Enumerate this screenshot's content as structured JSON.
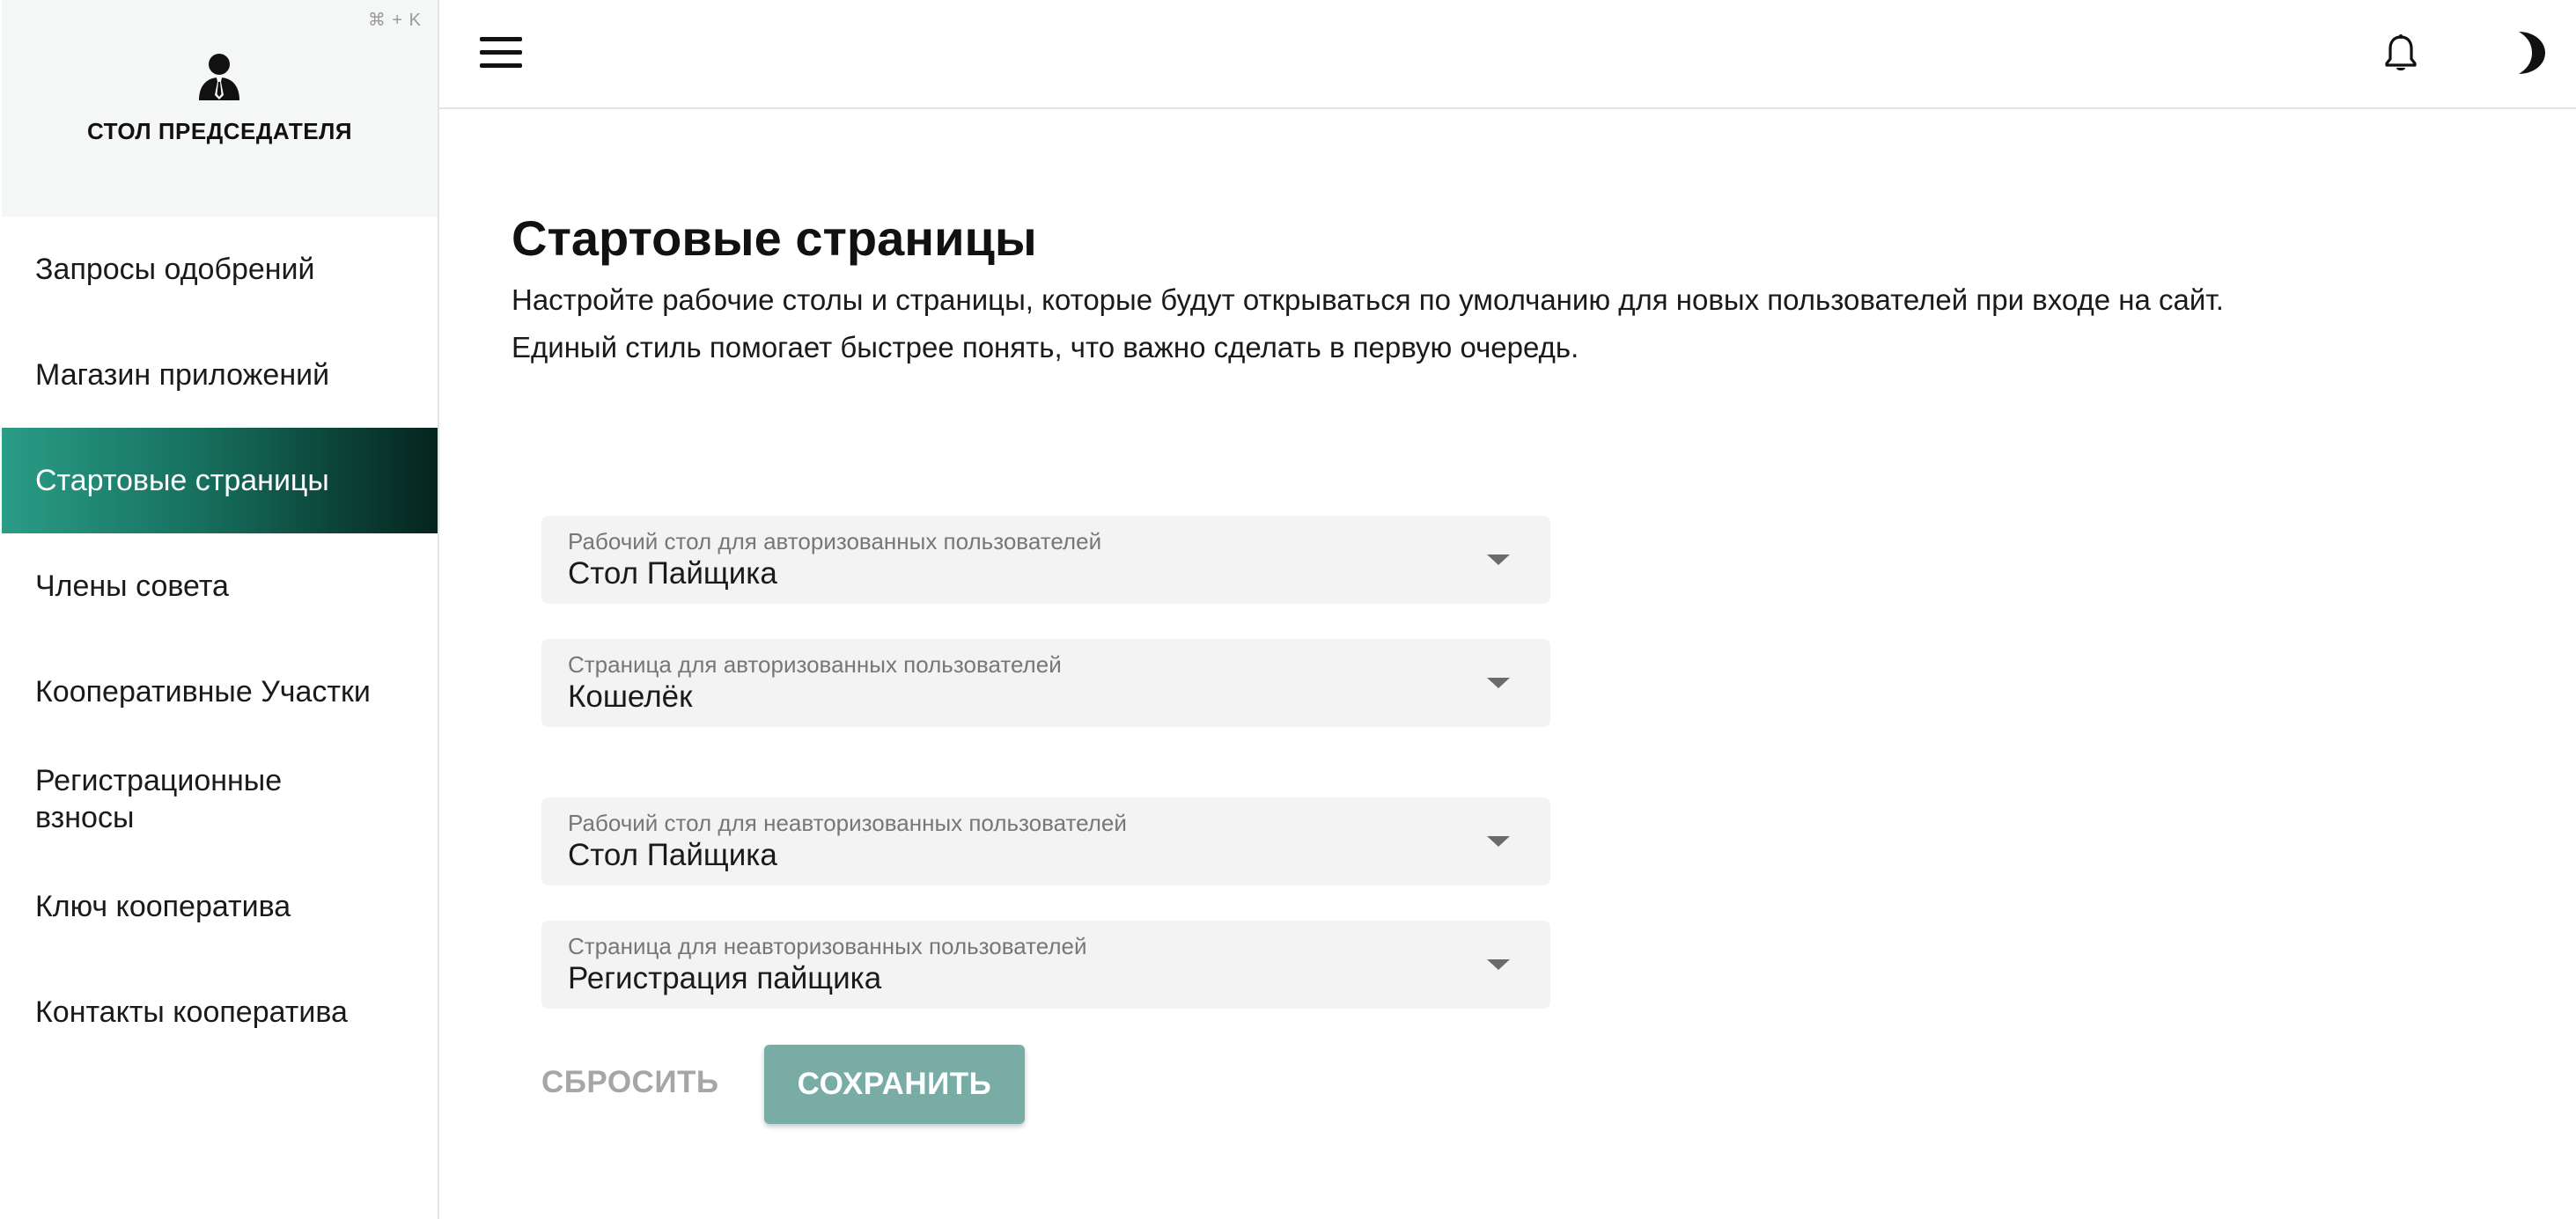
{
  "sidebar": {
    "shortcut": "⌘ + K",
    "org_title": "СТОЛ ПРЕДСЕДАТЕЛЯ",
    "items": [
      {
        "label": "Запросы одобрений"
      },
      {
        "label": "Магазин приложений"
      },
      {
        "label": "Стартовые страницы",
        "active": true
      },
      {
        "label": "Члены совета"
      },
      {
        "label": "Кооперативные Участки"
      },
      {
        "label": "Регистрационные взносы"
      },
      {
        "label": "Ключ кооператива"
      },
      {
        "label": "Контакты кооператива"
      }
    ]
  },
  "topbar": {
    "menu_icon": "hamburger-menu-icon",
    "notifications_icon": "bell-icon",
    "theme_icon": "moon-icon"
  },
  "main": {
    "title": "Стартовые страницы",
    "description": "Настройте рабочие столы и страницы, которые будут открываться по умолчанию для новых пользователей при входе на сайт. Единый стиль помогает быстрее понять, что важно сделать в первую очередь.",
    "fields": [
      {
        "label": "Рабочий стол для авторизованных пользователей",
        "value": "Стол Пайщика"
      },
      {
        "label": "Страница для авторизованных пользователей",
        "value": "Кошелёк"
      },
      {
        "label": "Рабочий стол для неавторизованных пользователей",
        "value": "Стол Пайщика"
      },
      {
        "label": "Страница для неавторизованных пользователей",
        "value": "Регистрация пайщика"
      }
    ],
    "reset_label": "СБРОСИТЬ",
    "save_label": "СОХРАНИТЬ"
  },
  "colors": {
    "accent": "#2a9d86",
    "accent_dark": "#04241d",
    "save_button": "#78aca4"
  }
}
